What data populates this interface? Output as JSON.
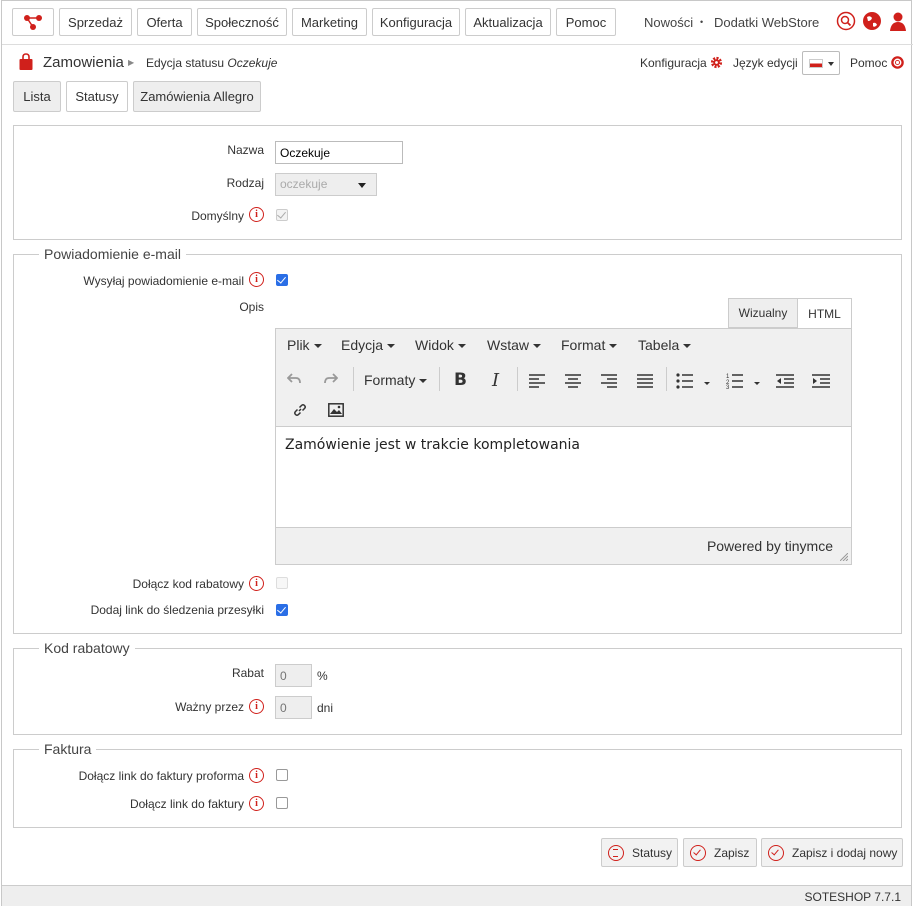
{
  "nav": {
    "items": [
      "Sprzedaż",
      "Oferta",
      "Społeczność",
      "Marketing",
      "Konfiguracja",
      "Aktualizacja",
      "Pomoc"
    ],
    "news": "Nowości",
    "separator": "•",
    "addons": "Dodatki WebStore"
  },
  "breadcrumb": {
    "module": "Zamowienia",
    "page": "Edycja statusu",
    "status_name": "Oczekuje"
  },
  "header_links": {
    "config": "Konfiguracja",
    "language": "Język edycji",
    "help": "Pomoc"
  },
  "tabs": [
    "Lista",
    "Statusy",
    "Zamówienia Allegro"
  ],
  "general": {
    "name_label": "Nazwa",
    "name_value": "Oczekuje",
    "type_label": "Rodzaj",
    "type_value": "oczekuje",
    "default_label": "Domyślny",
    "default_checked": true
  },
  "email": {
    "legend": "Powiadomienie e-mail",
    "send_label": "Wysyłaj powiadomienie e-mail",
    "send_checked": true,
    "desc_label": "Opis",
    "editor_tabs": [
      "Wizualny",
      "HTML"
    ],
    "menus": [
      "Plik",
      "Edycja",
      "Widok",
      "Wstaw",
      "Format",
      "Tabela"
    ],
    "formats_label": "Formaty",
    "content": "Zamówienie jest w trakcie kompletowania",
    "powered": "Powered by tinymce",
    "discount_label": "Dołącz kod rabatowy",
    "discount_checked": false,
    "tracking_label": "Dodaj link do śledzenia przesyłki",
    "tracking_checked": true
  },
  "discount": {
    "legend": "Kod rabatowy",
    "rate_label": "Rabat",
    "rate_placeholder": "0",
    "rate_unit": "%",
    "valid_label": "Ważny przez",
    "valid_placeholder": "0",
    "valid_unit": "dni"
  },
  "invoice": {
    "legend": "Faktura",
    "proforma_label": "Dołącz link do faktury proforma",
    "invoice_label": "Dołącz link do faktury"
  },
  "actions": {
    "statuses": "Statusy",
    "save": "Zapisz",
    "save_new": "Zapisz i dodaj nowy"
  },
  "footer": "SOTESHOP 7.7.1",
  "colors": {
    "accent": "#d0201b",
    "checkbox": "#2a6ee6"
  }
}
